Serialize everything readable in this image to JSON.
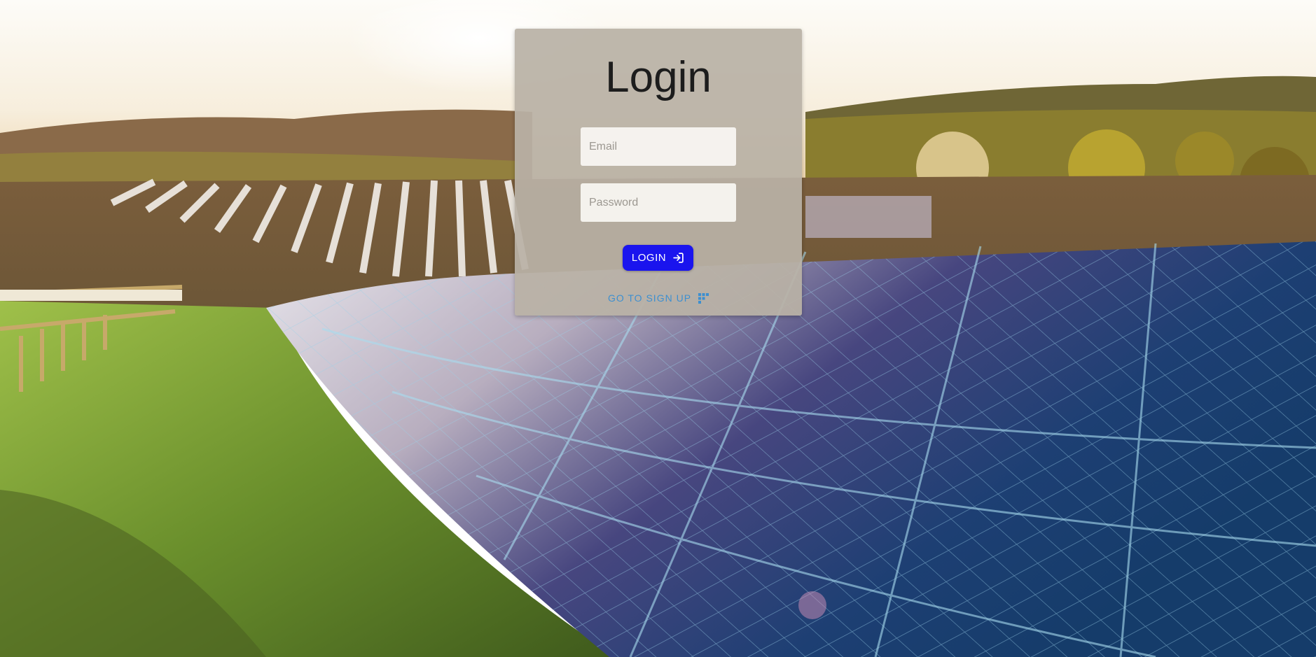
{
  "page": {
    "title": "Login"
  },
  "form": {
    "email_placeholder": "Email",
    "password_placeholder": "Password",
    "login_label": "LOGIN",
    "login_icon": "login-icon",
    "signup_label": "GO TO SIGN UP",
    "signup_icon": "grid-icon"
  },
  "colors": {
    "login_button": "#1a14ee",
    "signup_link": "#3d8fd0",
    "card_background": "#b9b2a6"
  },
  "background": {
    "description_icon": "solar-field-photo"
  }
}
